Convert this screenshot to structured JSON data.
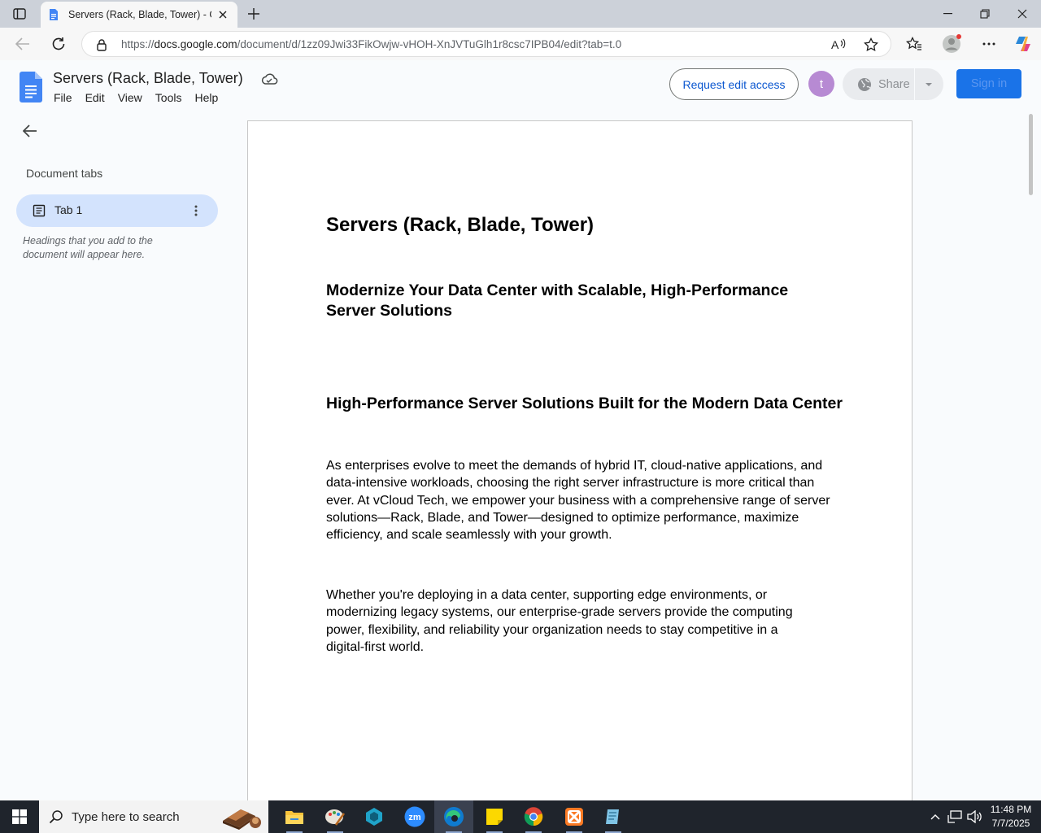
{
  "browser": {
    "tab_title": "Servers (Rack, Blade, Tower) - Google Docs",
    "url_prefix": "https://",
    "url_host": "docs.google.com",
    "url_path": "/document/d/1zz09Jwi33FikOwjw-vHOH-XnJVTuGlh1r8csc7IPB04/edit?tab=t.0"
  },
  "docs": {
    "title": "Servers (Rack, Blade, Tower)",
    "menu": [
      "File",
      "Edit",
      "View",
      "Tools",
      "Help"
    ],
    "request_edit_label": "Request edit access",
    "avatar_letter": "t",
    "share_label": "Share",
    "sign_in_label": "Sign in"
  },
  "sidebar": {
    "heading": "Document tabs",
    "tab_label": "Tab 1",
    "hint": "Headings that you add to the document will appear here."
  },
  "document": {
    "title": "Servers (Rack, Blade, Tower)",
    "heading_1": "Modernize Your Data Center with Scalable, High-Performance Server Solutions",
    "heading_2": "High-Performance Server Solutions Built for the Modern Data Center",
    "paragraph_1": "As enterprises evolve to meet the demands of hybrid IT, cloud-native applications, and data-intensive workloads, choosing the right server infrastructure is more critical than ever. At vCloud Tech, we empower your business with a comprehensive range of server solutions—Rack, Blade, and Tower—designed to optimize performance, maximize efficiency, and scale seamlessly with your growth.",
    "paragraph_2": "Whether you're deploying in a data center, supporting edge environments, or modernizing legacy systems, our enterprise-grade servers provide the computing power, flexibility, and reliability your organization needs to stay competitive in a digital-first world."
  },
  "taskbar": {
    "search_placeholder": "Type here to search",
    "time": "11:48 PM",
    "date": "7/7/2025",
    "apps": [
      "file-explorer",
      "paint-app",
      "app-diamond",
      "zoom-app",
      "edge-browser",
      "sticky-notes",
      "chrome-browser",
      "xampp-app",
      "notepad-app"
    ]
  },
  "colors": {
    "accent_blue": "#1a73e8",
    "active_tab_bg": "#d3e3fd",
    "request_text": "#0b57d0",
    "avatar_bg": "#b78ad3"
  }
}
